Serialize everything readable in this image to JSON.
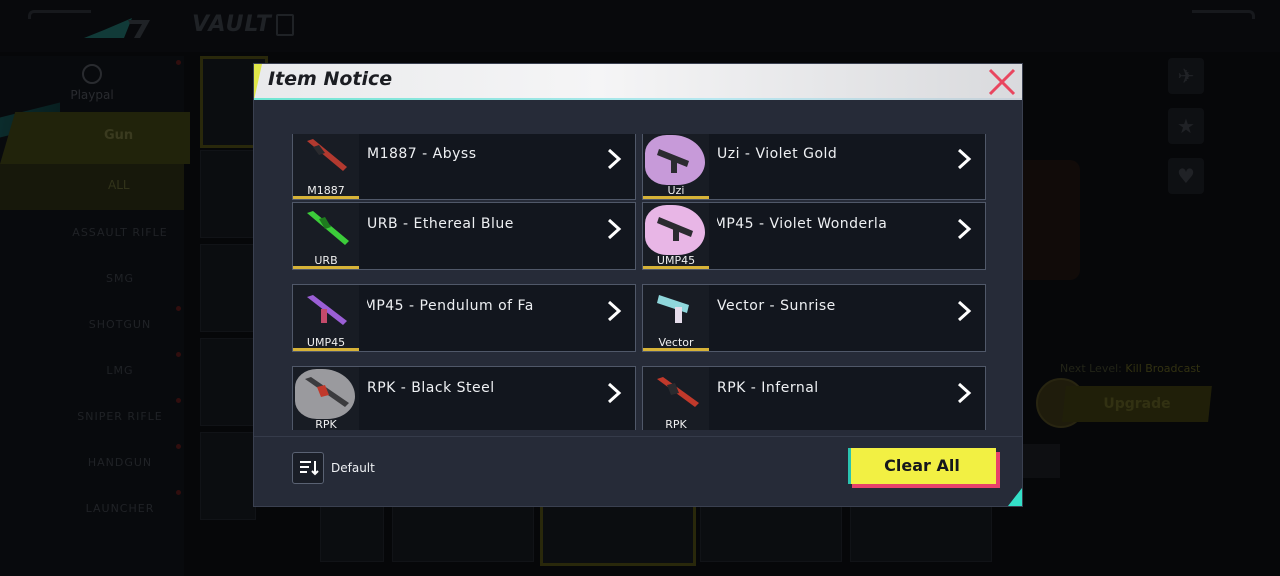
{
  "background": {
    "vault_title": "VAULT",
    "left_category": "Playpal",
    "gun_tab": "Gun",
    "all_tab": "ALL",
    "sidebar_items": [
      "ASSAULT RIFLE",
      "SMG",
      "SHOTGUN",
      "LMG",
      "SNIPER RIFLE",
      "HANDGUN",
      "LAUNCHER"
    ],
    "next_level_label": "Next Level:",
    "next_level_value": "Kill Broadcast",
    "upgrade_label": "Upgrade",
    "accent_color": "#f2f043"
  },
  "modal": {
    "title": "Item Notice",
    "close_icon": "close-x-icon",
    "items": [
      {
        "thumb_label": "M1887",
        "name": "M1887 - Abyss",
        "gun_color": "#b2392f",
        "splash": ""
      },
      {
        "thumb_label": "Uzi",
        "name": "Uzi - Violet Gold",
        "gun_color": "#2b2b30",
        "splash": "#c79ad9"
      },
      {
        "thumb_label": "URB",
        "name": "URB - Ethereal Blue",
        "gun_color": "#3ccc3a",
        "splash": ""
      },
      {
        "thumb_label": "UMP45",
        "name": "UMP45 - Violet Wonderla",
        "gun_color": "#2b2b30",
        "splash": "#e8b6e6"
      },
      {
        "thumb_label": "UMP45",
        "name": "UMP45 - Pendulum of Fa",
        "gun_color": "#9b5fd6",
        "splash": ""
      },
      {
        "thumb_label": "Vector",
        "name": "Vector - Sunrise",
        "gun_color": "#8fd7dc",
        "splash": ""
      },
      {
        "thumb_label": "RPK",
        "name": "RPK - Black Steel",
        "gun_color": "#3b3b3e",
        "splash": "#9a9a9e"
      },
      {
        "thumb_label": "RPK",
        "name": "RPK - Infernal",
        "gun_color": "#c0392b",
        "splash": ""
      }
    ],
    "sort_label": "Default",
    "sort_icon": "sort-icon",
    "clear_all_label": "Clear All",
    "clear_button_color": "#f2f043",
    "rarity_color": "#d7b338"
  }
}
